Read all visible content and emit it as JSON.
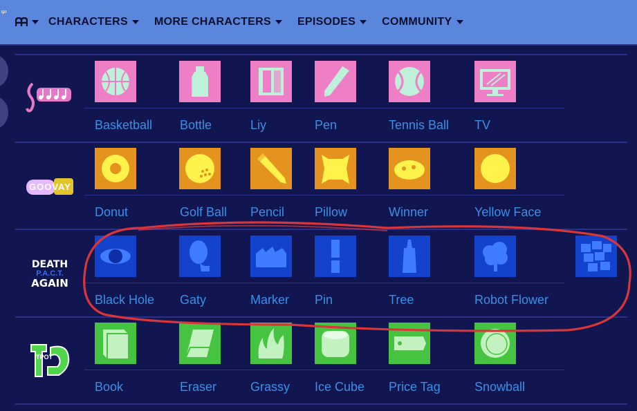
{
  "nav": {
    "corner_text": "ιμι",
    "items": [
      {
        "label": "CHARACTERS"
      },
      {
        "label": "MORE CHARACTERS"
      },
      {
        "label": "EPISODES"
      },
      {
        "label": "COMMUNITY"
      }
    ]
  },
  "logos": {
    "row2_text": "GOOVAY",
    "row3_line1": "DEATH",
    "row3_line2": "P.A.C.T.",
    "row3_line3": "AGAIN",
    "row4_text": "TPOT"
  },
  "rows": [
    {
      "color": "#ee7ec6",
      "items": [
        {
          "name": "Basketball",
          "icon": "basketball-icon"
        },
        {
          "name": "Bottle",
          "icon": "bottle-icon"
        },
        {
          "name": "Liy",
          "icon": "book-liy-icon"
        },
        {
          "name": "Pen",
          "icon": "pen-icon"
        },
        {
          "name": "Tennis Ball",
          "icon": "tennis-ball-icon"
        },
        {
          "name": "TV",
          "icon": "tv-icon"
        }
      ]
    },
    {
      "color": "#e5931f",
      "items": [
        {
          "name": "Donut",
          "icon": "donut-icon"
        },
        {
          "name": "Golf Ball",
          "icon": "golf-ball-icon"
        },
        {
          "name": "Pencil",
          "icon": "pencil-icon"
        },
        {
          "name": "Pillow",
          "icon": "pillow-icon"
        },
        {
          "name": "Winner",
          "icon": "winner-icon"
        },
        {
          "name": "Yellow Face",
          "icon": "yellow-face-icon"
        }
      ]
    },
    {
      "color": "#1343cc",
      "items": [
        {
          "name": "Black Hole",
          "icon": "black-hole-icon"
        },
        {
          "name": "Gaty",
          "icon": "gaty-icon"
        },
        {
          "name": "Marker",
          "icon": "marker-icon"
        },
        {
          "name": "Pin",
          "icon": "pin-icon"
        },
        {
          "name": "Tree",
          "icon": "tree-icon"
        },
        {
          "name": "Robot Flower",
          "icon": "robot-flower-icon"
        },
        {
          "name": "",
          "icon": "cubes-icon"
        }
      ]
    },
    {
      "color": "#46c441",
      "items": [
        {
          "name": "Book",
          "icon": "book-icon"
        },
        {
          "name": "Eraser",
          "icon": "eraser-icon"
        },
        {
          "name": "Grassy",
          "icon": "grassy-icon"
        },
        {
          "name": "Ice Cube",
          "icon": "ice-cube-icon"
        },
        {
          "name": "Price Tag",
          "icon": "price-tag-icon"
        },
        {
          "name": "Snowball",
          "icon": "snowball-icon"
        }
      ]
    }
  ]
}
